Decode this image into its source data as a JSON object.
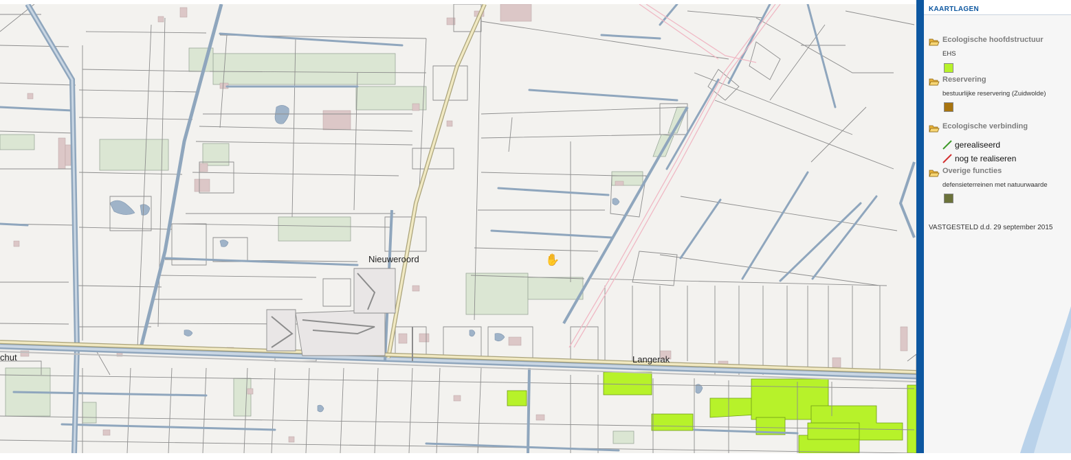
{
  "map": {
    "places": [
      {
        "name": "Nieuweroord"
      },
      {
        "name": "Langerak"
      },
      {
        "name": "chut"
      }
    ],
    "cursor": "hand-pan-icon"
  },
  "legend": {
    "title": "KAARTLAGEN",
    "layers": [
      {
        "title": "Ecologische hoofdstructuur",
        "icon": "folder-open-icon",
        "items": [
          {
            "label": "EHS",
            "color": "#b7f22a",
            "symbol": "square"
          }
        ]
      },
      {
        "title": "Reservering",
        "icon": "folder-open-icon",
        "items": [
          {
            "label": "bestuurlijke reservering (Zuidwolde)",
            "color": "#a8740f",
            "symbol": "square"
          }
        ]
      },
      {
        "title": "Ecologische verbinding",
        "icon": "folder-open-icon",
        "items": [
          {
            "label": "gerealiseerd",
            "color": "#3e9a2a",
            "symbol": "line"
          },
          {
            "label": "nog te realiseren",
            "color": "#d33030",
            "symbol": "line"
          }
        ]
      },
      {
        "title": "Overige functies",
        "icon": "folder-open-icon",
        "items": [
          {
            "label": "defensieterreinen met natuurwaarde",
            "color": "#6b723a",
            "symbol": "square"
          }
        ]
      }
    ],
    "status": "VASTGESTELD d.d. 29 september 2015"
  },
  "colors": {
    "map_background": "#f3f2ef",
    "parcel_line": "#8c8c8c",
    "water": "#9fb3c8",
    "road_fill": "#f1e9c2",
    "meadow": "#dbe6d3",
    "ehs_green": "#b7f22a",
    "building": "#dcc7c7",
    "rail": "#f0b8c4",
    "panel_blue": "#0d57a0"
  }
}
